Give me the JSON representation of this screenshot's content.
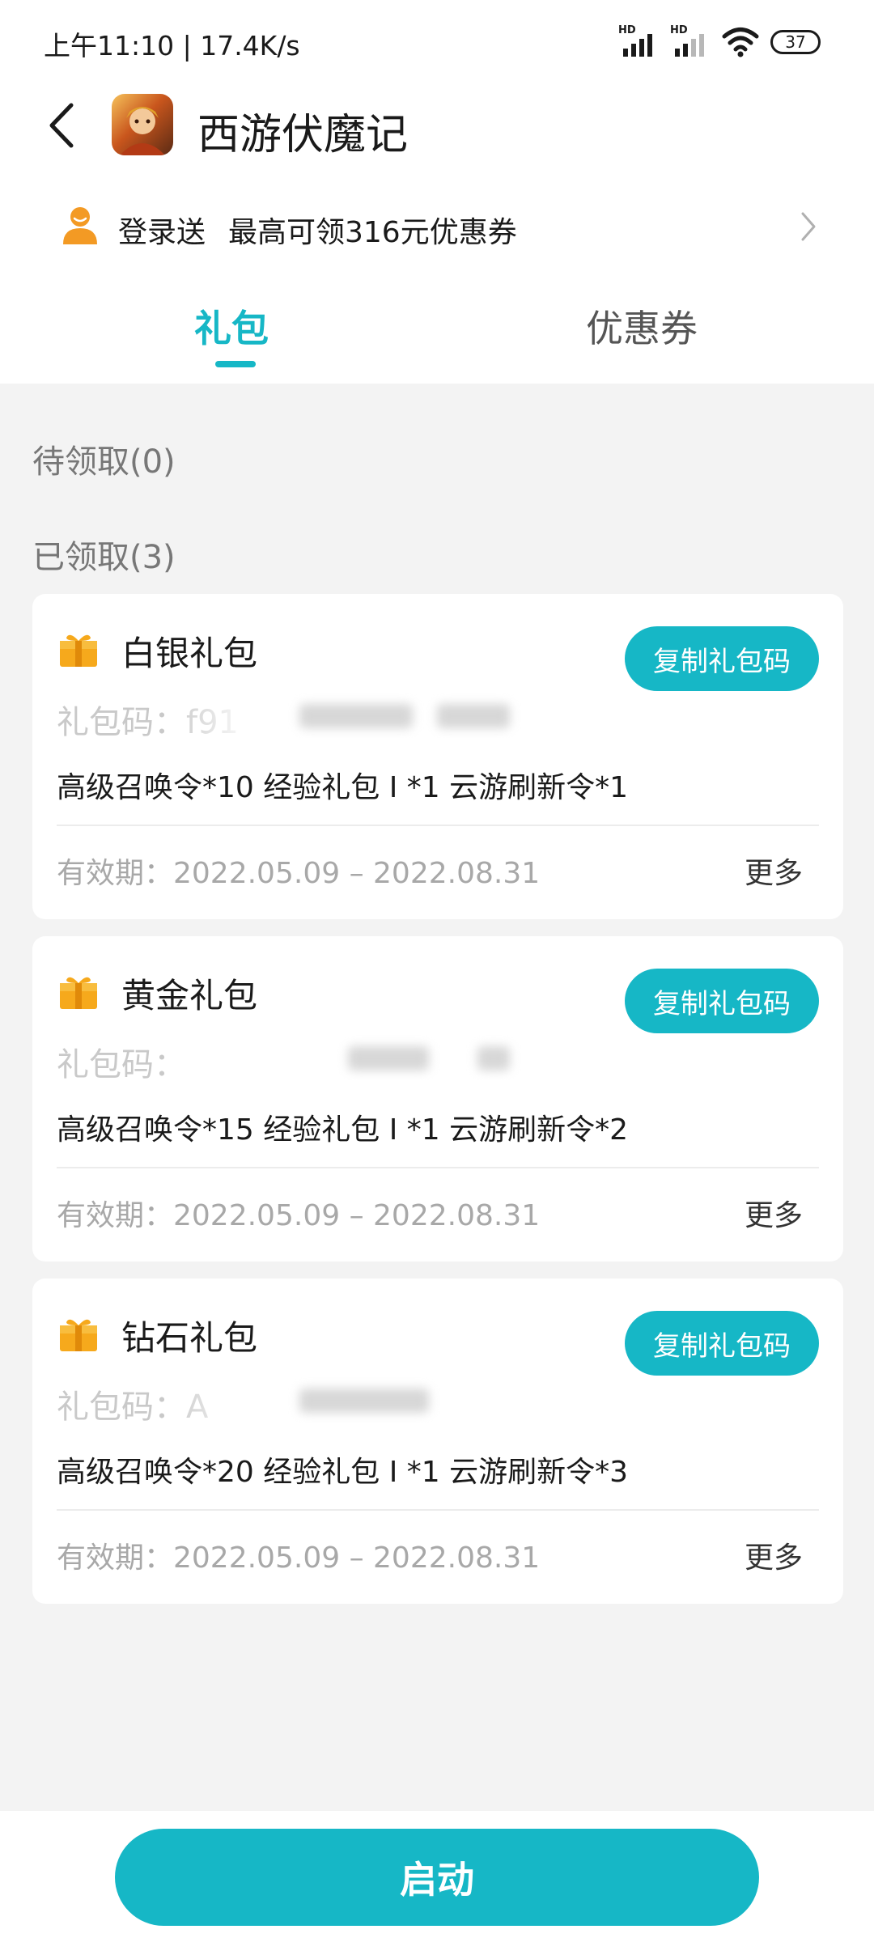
{
  "status_bar": {
    "time_speed": "上午11:10 | 17.4K/s",
    "signal1_label": "HD",
    "signal2_label": "HD",
    "battery": "37"
  },
  "header": {
    "title": "西游伏魔记",
    "icon": "game-app-icon"
  },
  "promo": {
    "prefix": "登录送",
    "text": "最高可领316元优惠券"
  },
  "tabs": [
    {
      "label": "礼包",
      "active": true
    },
    {
      "label": "优惠券",
      "active": false
    }
  ],
  "sections": {
    "pending": "待领取(0)",
    "claimed": "已领取(3)"
  },
  "gifts": [
    {
      "name": "白银礼包",
      "copy_label": "复制礼包码",
      "code_label": "礼包码：f91",
      "items": "高级召唤令*10 经验礼包 I *1 云游刷新令*1",
      "validity": "有效期：2022.05.09 – 2022.08.31",
      "more": "更多"
    },
    {
      "name": "黄金礼包",
      "copy_label": "复制礼包码",
      "code_label": "礼包码：",
      "items": "高级召唤令*15 经验礼包 I *1 云游刷新令*2",
      "validity": "有效期：2022.05.09 – 2022.08.31",
      "more": "更多"
    },
    {
      "name": "钻石礼包",
      "copy_label": "复制礼包码",
      "code_label": "礼包码：A",
      "items": "高级召唤令*20 经验礼包 I *1 云游刷新令*3",
      "validity": "有效期：2022.05.09 – 2022.08.31",
      "more": "更多"
    }
  ],
  "launch_button": "启动",
  "colors": {
    "accent": "#16b7c6",
    "gift_icon": "#f6a91c",
    "user_icon": "#f39a24"
  }
}
